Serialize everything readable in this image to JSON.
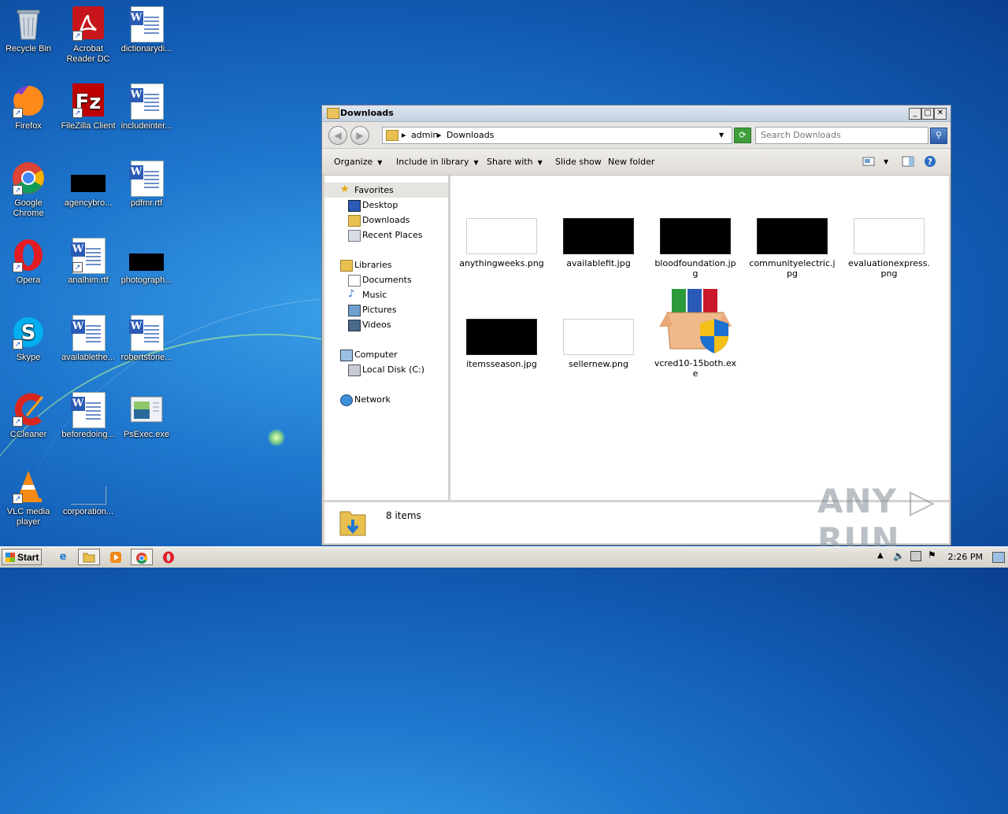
{
  "desktop": {
    "icons": [
      {
        "label": "Recycle Bin"
      },
      {
        "label": "Acrobat Reader DC"
      },
      {
        "label": "dictionarydi..."
      },
      {
        "label": "Firefox"
      },
      {
        "label": "FileZilla Client"
      },
      {
        "label": "includeinter..."
      },
      {
        "label": "Google Chrome"
      },
      {
        "label": "agencybro..."
      },
      {
        "label": "pdfmr.rtf"
      },
      {
        "label": "Opera"
      },
      {
        "label": "analhim.rtf"
      },
      {
        "label": "photograph..."
      },
      {
        "label": "Skype"
      },
      {
        "label": "availablethe..."
      },
      {
        "label": "robertstorie..."
      },
      {
        "label": "CCleaner"
      },
      {
        "label": "beforedoing..."
      },
      {
        "label": "PsExec.exe"
      },
      {
        "label": "VLC media player"
      },
      {
        "label": "corporation..."
      }
    ]
  },
  "window": {
    "title": "Downloads",
    "controls": {
      "minimize": "_",
      "maximize": "□",
      "close": "✕"
    },
    "nav": {
      "back": "◀",
      "forward": "▶"
    },
    "address": {
      "crumbs": [
        "admin",
        "Downloads"
      ],
      "separator": "▸"
    },
    "search": {
      "placeholder": "Search Downloads"
    },
    "toolbar": {
      "organize": "Organize",
      "include_in_library": "Include in library",
      "share_with": "Share with",
      "slide_show": "Slide show",
      "new_folder": "New folder"
    },
    "sidebar": {
      "favorites": "Favorites",
      "favorites_items": [
        "Desktop",
        "Downloads",
        "Recent Places"
      ],
      "libraries": "Libraries",
      "libraries_items": [
        "Documents",
        "Music",
        "Pictures",
        "Videos"
      ],
      "computer": "Computer",
      "computer_items": [
        "Local Disk (C:)"
      ],
      "network": "Network"
    },
    "files": [
      {
        "name": "anythingweeks.png",
        "thumb": "white"
      },
      {
        "name": "availablefit.jpg",
        "thumb": "black"
      },
      {
        "name": "bloodfoundation.jpg",
        "thumb": "black"
      },
      {
        "name": "communityelectric.jpg",
        "thumb": "black"
      },
      {
        "name": "evaluationexpress.png",
        "thumb": "white"
      },
      {
        "name": "itemsseason.jpg",
        "thumb": "black"
      },
      {
        "name": "sellernew.png",
        "thumb": "white"
      },
      {
        "name": "vcred10-15both.exe",
        "thumb": "installer"
      }
    ],
    "status": {
      "count": "8 items"
    }
  },
  "watermark": "ANY ▷ RUN",
  "taskbar": {
    "start_label": "Start",
    "clock": "2:26 PM"
  },
  "colors": {
    "accent": "#1f78cf",
    "selection": "#e6e4e0"
  }
}
